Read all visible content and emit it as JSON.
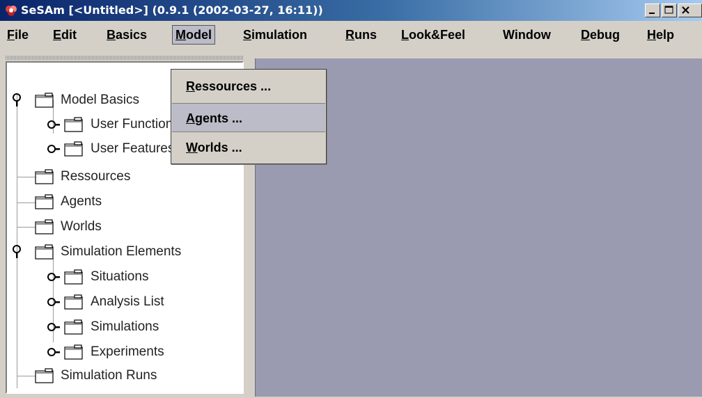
{
  "window": {
    "title": "SeSAm [<Untitled>] (0.9.1 (2002-03-27, 16:11))",
    "colors": {
      "title_start": "#0a246a",
      "title_end": "#a6caf0",
      "desktop": "#9a9ab0",
      "menu_bg": "#d4d0c8"
    }
  },
  "menubar": {
    "file": {
      "m": "F",
      "rest": "ile"
    },
    "edit": {
      "m": "E",
      "rest": "dit"
    },
    "basics": {
      "m": "B",
      "rest": "asics"
    },
    "model": {
      "m": "M",
      "rest": "odel"
    },
    "simulation": {
      "m": "S",
      "rest": "imulation"
    },
    "runs": {
      "m": "R",
      "rest": "uns"
    },
    "lookfeel": {
      "m": "L",
      "rest": "ook&Feel"
    },
    "window": {
      "m": "",
      "rest": "Window"
    },
    "debug": {
      "m": "D",
      "rest": "ebug"
    },
    "help": {
      "m": "H",
      "rest": "elp"
    }
  },
  "model_menu": {
    "items": [
      {
        "m": "R",
        "rest": "essources ..."
      },
      {
        "m": "A",
        "rest": "gents ..."
      },
      {
        "m": "W",
        "rest": "orlds ..."
      }
    ]
  },
  "tree": {
    "nodes": [
      {
        "label": "Model Basics"
      },
      {
        "label": "User Functions"
      },
      {
        "label": "User Features"
      },
      {
        "label": "Ressources"
      },
      {
        "label": "Agents"
      },
      {
        "label": "Worlds"
      },
      {
        "label": "Simulation Elements"
      },
      {
        "label": "Situations"
      },
      {
        "label": "Analysis List"
      },
      {
        "label": "Simulations"
      },
      {
        "label": "Experiments"
      },
      {
        "label": "Simulation Runs"
      }
    ]
  },
  "icons": {
    "app": "sesam-app-icon",
    "folder": "folder-icon",
    "expanded": "expanded-handle-icon",
    "collapsed": "collapsed-handle-icon"
  }
}
